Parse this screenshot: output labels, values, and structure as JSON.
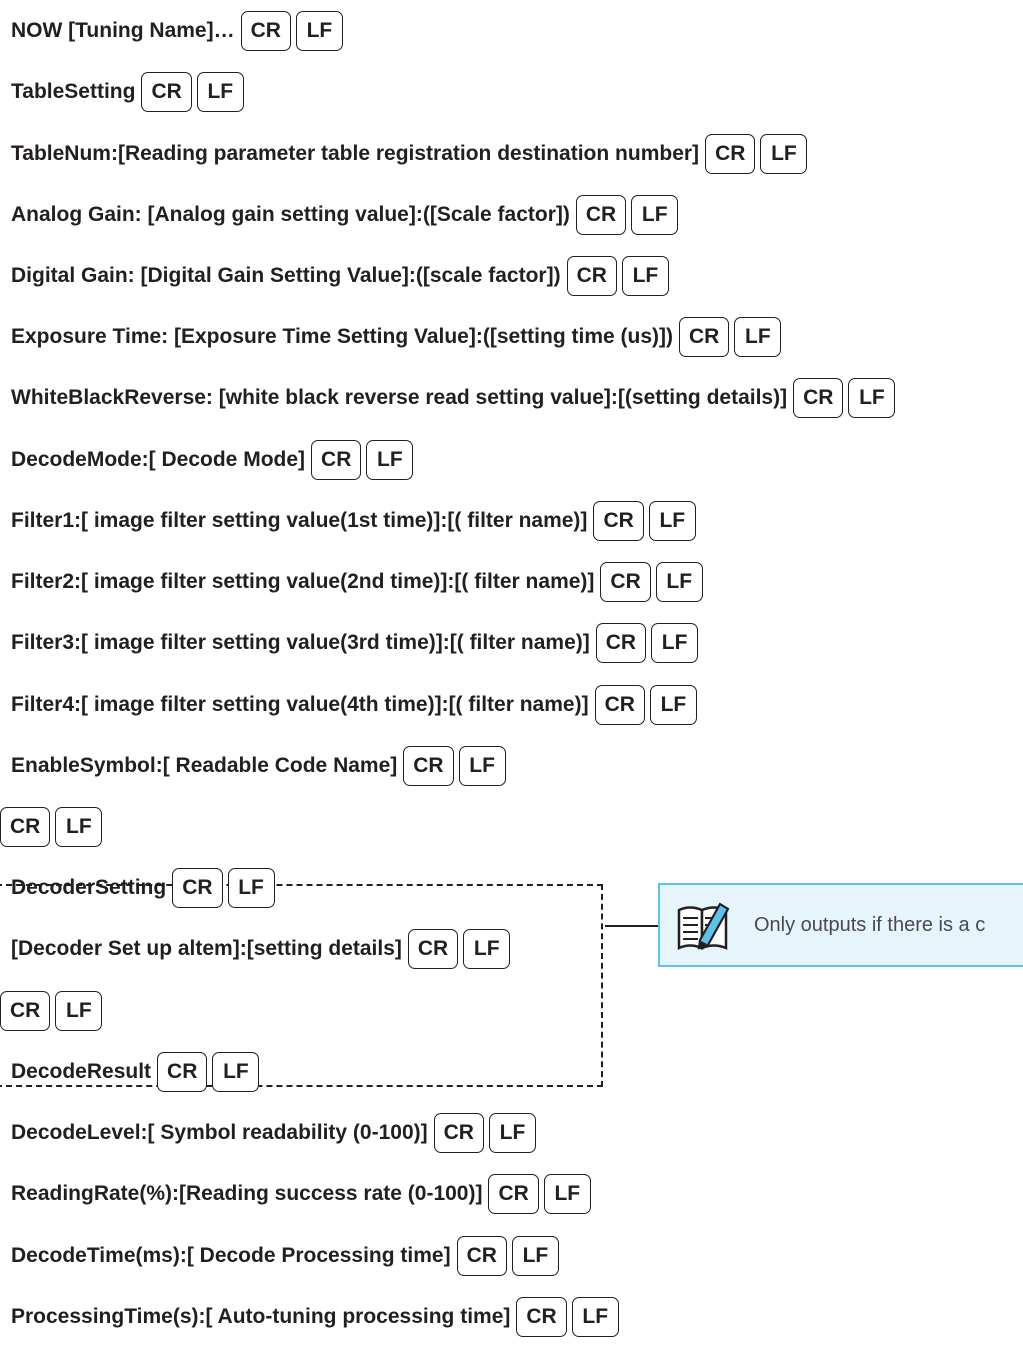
{
  "keys": {
    "cr": "CR",
    "lf": "LF"
  },
  "lines": [
    {
      "text": "NOW [Tuning Name]…"
    },
    {
      "text": "TableSetting"
    },
    {
      "text": "TableNum:[Reading parameter table registration destination number]"
    },
    {
      "text": "Analog Gain: [Analog gain setting value]:([Scale factor])"
    },
    {
      "text": "Digital Gain: [Digital Gain Setting Value]:([scale factor])"
    },
    {
      "text": "Exposure Time: [Exposure Time Setting Value]:([setting time (us)])"
    },
    {
      "text": "WhiteBlackReverse: [white black reverse read setting value]:[(setting details)]"
    },
    {
      "text": "DecodeMode:[ Decode Mode]"
    },
    {
      "text": "Filter1:[ image filter setting value(1st time)]:[( filter name)]"
    },
    {
      "text": "Filter2:[ image filter setting value(2nd time)]:[( filter name)]"
    },
    {
      "text": "Filter3:[ image filter setting value(3rd time)]:[( filter name)]"
    },
    {
      "text": "Filter4:[ image filter setting value(4th time)]:[( filter name)]"
    },
    {
      "text": "EnableSymbol:[ Readable Code Name]"
    },
    {
      "text": ""
    },
    {
      "text": "DecoderSetting"
    },
    {
      "text": "[Decoder Set up altem]:[setting details]"
    },
    {
      "text": ""
    },
    {
      "text": "DecodeResult"
    },
    {
      "text": "DecodeLevel:[ Symbol readability (0-100)]"
    },
    {
      "text": "ReadingRate(%):[Reading success rate (0-100)]"
    },
    {
      "text": "DecodeTime(ms):[ Decode Processing time]"
    },
    {
      "text": "ProcessingTime(s):[ Auto-tuning processing time]"
    }
  ],
  "note": {
    "text": "Only outputs if there is a c",
    "icon": "notepad-pencil-icon",
    "accent": "#5fc2e8",
    "background": "#e6f4fb"
  }
}
